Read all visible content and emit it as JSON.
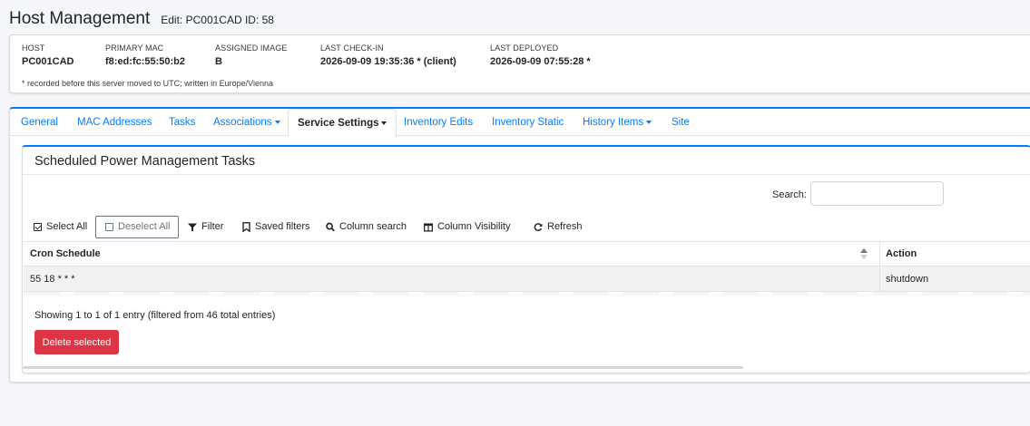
{
  "header": {
    "title": "Host Management",
    "subtitle": "Edit: PC001CAD ID: 58"
  },
  "host_info": {
    "fields": [
      {
        "label": "HOST",
        "value": "PC001CAD"
      },
      {
        "label": "PRIMARY MAC",
        "value": "f8:ed:fc:55:50:b2"
      },
      {
        "label": "ASSIGNED IMAGE",
        "value": "B"
      },
      {
        "label": "LAST CHECK-IN",
        "value": "2026-09-09 19:35:36 * (client)"
      },
      {
        "label": "LAST DEPLOYED",
        "value": "2026-09-09 07:55:28 *"
      }
    ],
    "note": "* recorded before this server moved to UTC; written in Europe/Vienna"
  },
  "tabs": [
    {
      "label": "General",
      "dropdown": false,
      "active": false
    },
    {
      "label": "MAC Addresses",
      "dropdown": false,
      "active": false
    },
    {
      "label": "Tasks",
      "dropdown": false,
      "active": false
    },
    {
      "label": "Associations",
      "dropdown": true,
      "active": false
    },
    {
      "label": "Service Settings",
      "dropdown": true,
      "active": true
    },
    {
      "label": "Inventory Edits",
      "dropdown": false,
      "active": false
    },
    {
      "label": "Inventory Static",
      "dropdown": false,
      "active": false
    },
    {
      "label": "History Items",
      "dropdown": true,
      "active": false
    },
    {
      "label": "Site",
      "dropdown": false,
      "active": false
    }
  ],
  "panel": {
    "title": "Scheduled Power Management Tasks",
    "search": {
      "label": "Search:",
      "value": "",
      "placeholder": ""
    },
    "toolbar": {
      "select_all": "Select All",
      "deselect_all": "Deselect All",
      "filter": "Filter",
      "saved_filters": "Saved filters",
      "column_search": "Column search",
      "column_visibility": "Column Visibility",
      "refresh": "Refresh"
    },
    "table": {
      "columns": [
        "Cron Schedule",
        "Action"
      ],
      "rows": [
        {
          "cron": "55 18 * * *",
          "action": "shutdown"
        }
      ]
    },
    "info": "Showing 1 to 1 of 1 entry (filtered from 46 total entries)",
    "delete_label": "Delete selected"
  },
  "colors": {
    "primary": "#007bff",
    "danger": "#dc3545",
    "background": "#f4f6f9"
  }
}
